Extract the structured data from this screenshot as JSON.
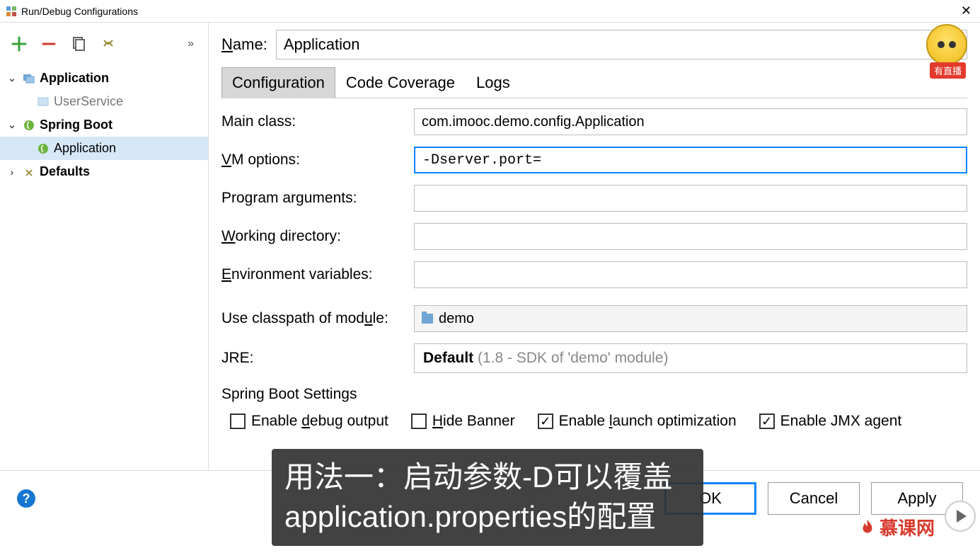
{
  "window": {
    "title": "Run/Debug Configurations"
  },
  "tree": {
    "nodes": [
      {
        "label": "Application",
        "bold": true,
        "expanded": true
      },
      {
        "label": "UserService",
        "child": true
      },
      {
        "label": "Spring Boot",
        "bold": true,
        "expanded": true
      },
      {
        "label": "Application",
        "child": true,
        "selected": true
      },
      {
        "label": "Defaults",
        "bold": true,
        "expanded": false
      }
    ]
  },
  "form": {
    "name_label_prefix": "N",
    "name_label_rest": "ame:",
    "name_value": "Application",
    "tabs": {
      "configuration": "Configuration",
      "code_coverage": "Code Coverage",
      "logs": "Logs"
    },
    "main_class_label": "Main class:",
    "main_class_value": "com.imooc.demo.config.Application",
    "vm_options_label_prefix": "V",
    "vm_options_label_rest": "M options:",
    "vm_options_value": "-Dserver.port=",
    "program_args_label_pre": "Program ar",
    "program_args_label_u": "g",
    "program_args_label_post": "uments:",
    "program_args_value": "",
    "working_dir_label_prefix": "W",
    "working_dir_label_rest": "orking directory:",
    "working_dir_value": "",
    "env_label_prefix": "E",
    "env_label_rest": "nvironment variables:",
    "env_value": "",
    "classpath_label_pre": "Use classpath of mod",
    "classpath_label_u": "u",
    "classpath_label_post": "le:",
    "classpath_value": "demo",
    "jre_label": "JRE:",
    "jre_value_bold": "Default",
    "jre_value_gray": "(1.8 - SDK of 'demo' module)",
    "spring_section": "Spring Boot Settings",
    "checks": {
      "debug_pre": "Enable ",
      "debug_u": "d",
      "debug_post": "ebug output",
      "hide_pre": "",
      "hide_u": "H",
      "hide_post": "ide Banner",
      "launch_pre": "Enable ",
      "launch_u": "l",
      "launch_post": "aunch optimization",
      "jmx": "Enable JMX agent"
    }
  },
  "buttons": {
    "ok": "OK",
    "cancel": "Cancel",
    "apply": "Apply"
  },
  "overlay": {
    "subtitle": "用法一：启动参数-D可以覆盖application.properties的配置",
    "live_badge": "有直播",
    "brand": "慕课网"
  }
}
